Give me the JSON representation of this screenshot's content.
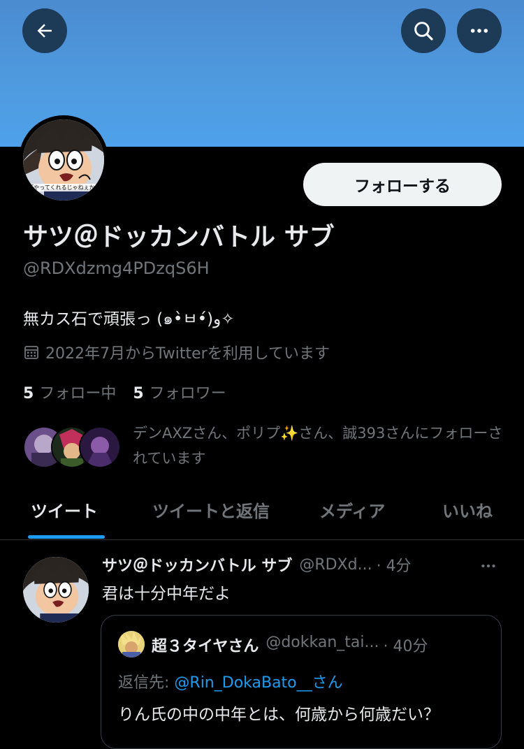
{
  "header": {
    "back_icon": "arrow-left-icon",
    "search_icon": "search-icon",
    "more_icon": "more-horizontal-icon",
    "banner_color": "#4f9be0"
  },
  "profile": {
    "avatar_caption": "「やってくれるじゃねぇか」",
    "follow_label": "フォローする",
    "name": "サツ＠ドッカンバトル サブ",
    "handle": "@RDXdzmg4PDzqS6H",
    "bio": "無カス石で頑張っ (๑•̀ㅂ•́)و✧",
    "joined": "2022年7月からTwitterを利用しています",
    "following_count": "5",
    "following_label": "フォロー中",
    "followers_count": "5",
    "followers_label": "フォロワー",
    "followed_by": "デンAXZさん、ポリプ✨さん、誠393さんにフォローされています"
  },
  "tabs": [
    {
      "label": "ツイート",
      "active": true
    },
    {
      "label": "ツイートと返信",
      "active": false
    },
    {
      "label": "メディア",
      "active": false
    },
    {
      "label": "いいね",
      "active": false
    }
  ],
  "tweet": {
    "author": "サツ＠ドッカンバトル サブ",
    "handle": "@RDXd...",
    "time": "· 4分",
    "text": "君は十分中年だよ",
    "quote": {
      "author": "超３タイヤさん",
      "handle": "@dokkan_tai...",
      "time": "· 40分",
      "reply_prefix": "返信先: ",
      "reply_to": "@Rin_DokaBato__さん",
      "text": "りん氏の中の中年とは、何歳から何歳だい？"
    }
  },
  "colors": {
    "accent": "#1d9bf0",
    "muted": "#71767b",
    "text": "#e7e9ea",
    "background": "#000000"
  }
}
